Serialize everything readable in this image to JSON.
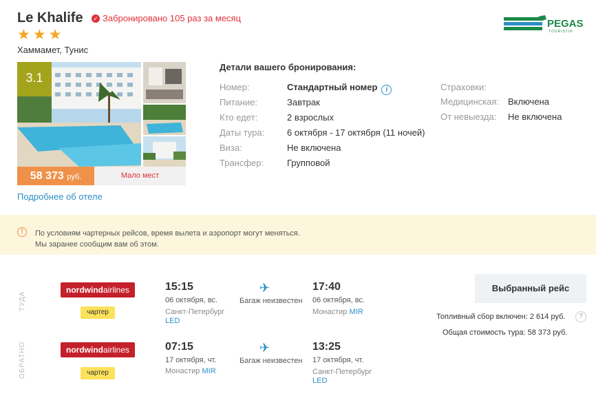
{
  "hotel": {
    "name": "Le Khalife",
    "booked_text": "Забронировано 105 раз за месяц",
    "stars": 3,
    "location": "Хаммамет, Тунис",
    "rating": "3.1",
    "price": "58 373",
    "currency": "руб.",
    "seats": "Мало мест",
    "more_link": "Подробнее об отеле"
  },
  "operator": {
    "name": "PEGAS",
    "sub": "TOURISTIK",
    "brand_color": "#1a8a4a"
  },
  "details": {
    "title": "Детали вашего бронирования:",
    "rows": [
      {
        "label": "Номер:",
        "value": "Стандартный номер"
      },
      {
        "label": "Питание:",
        "value": "Завтрак"
      },
      {
        "label": "Кто едет:",
        "value": "2 взрослых"
      },
      {
        "label": "Даты тура:",
        "value": "6 октября - 17 октября (11 ночей)"
      },
      {
        "label": "Виза:",
        "value": "Не включена"
      },
      {
        "label": "Трансфер:",
        "value": "Групповой"
      }
    ],
    "insurance": [
      {
        "label": "Страховки:",
        "value": ""
      },
      {
        "label": "Медицинская:",
        "value": "Включена"
      },
      {
        "label": "От невыезда:",
        "value": "Не включена"
      }
    ]
  },
  "notice": {
    "line1": "По условиям чартерных рейсов, время вылета и аэропорт могут меняться.",
    "line2": "Мы заранее сообщим вам об этом."
  },
  "flights": [
    {
      "direction": "ТУДА",
      "airline_bold": "nordwind",
      "airline_light": "airlines",
      "type": "чартер",
      "dep_time": "15:15",
      "dep_date": "06 октября, вс.",
      "dep_city": "Санкт-Петербург",
      "dep_code": "LED",
      "baggage": "Багаж неизвестен",
      "arr_time": "17:40",
      "arr_date": "06 октября, вс.",
      "arr_city": "Монастир",
      "arr_code": "MIR"
    },
    {
      "direction": "ОБРАТНО",
      "airline_bold": "nordwind",
      "airline_light": "airlines",
      "type": "чартер",
      "dep_time": "07:15",
      "dep_date": "17 октября, чт.",
      "dep_city": "Монастир",
      "dep_code": "MIR",
      "baggage": "Багаж неизвестен",
      "arr_time": "13:25",
      "arr_date": "17 октября, чт.",
      "arr_city": "Санкт-Петербург",
      "arr_code": "LED"
    }
  ],
  "summary": {
    "select_button": "Выбранный рейс",
    "fuel_label": "Топливный сбор включен:",
    "fuel_value": "2 614 руб.",
    "total_label": "Общая стоимость тура:",
    "total_value": "58 373 руб.",
    "help": "?"
  }
}
